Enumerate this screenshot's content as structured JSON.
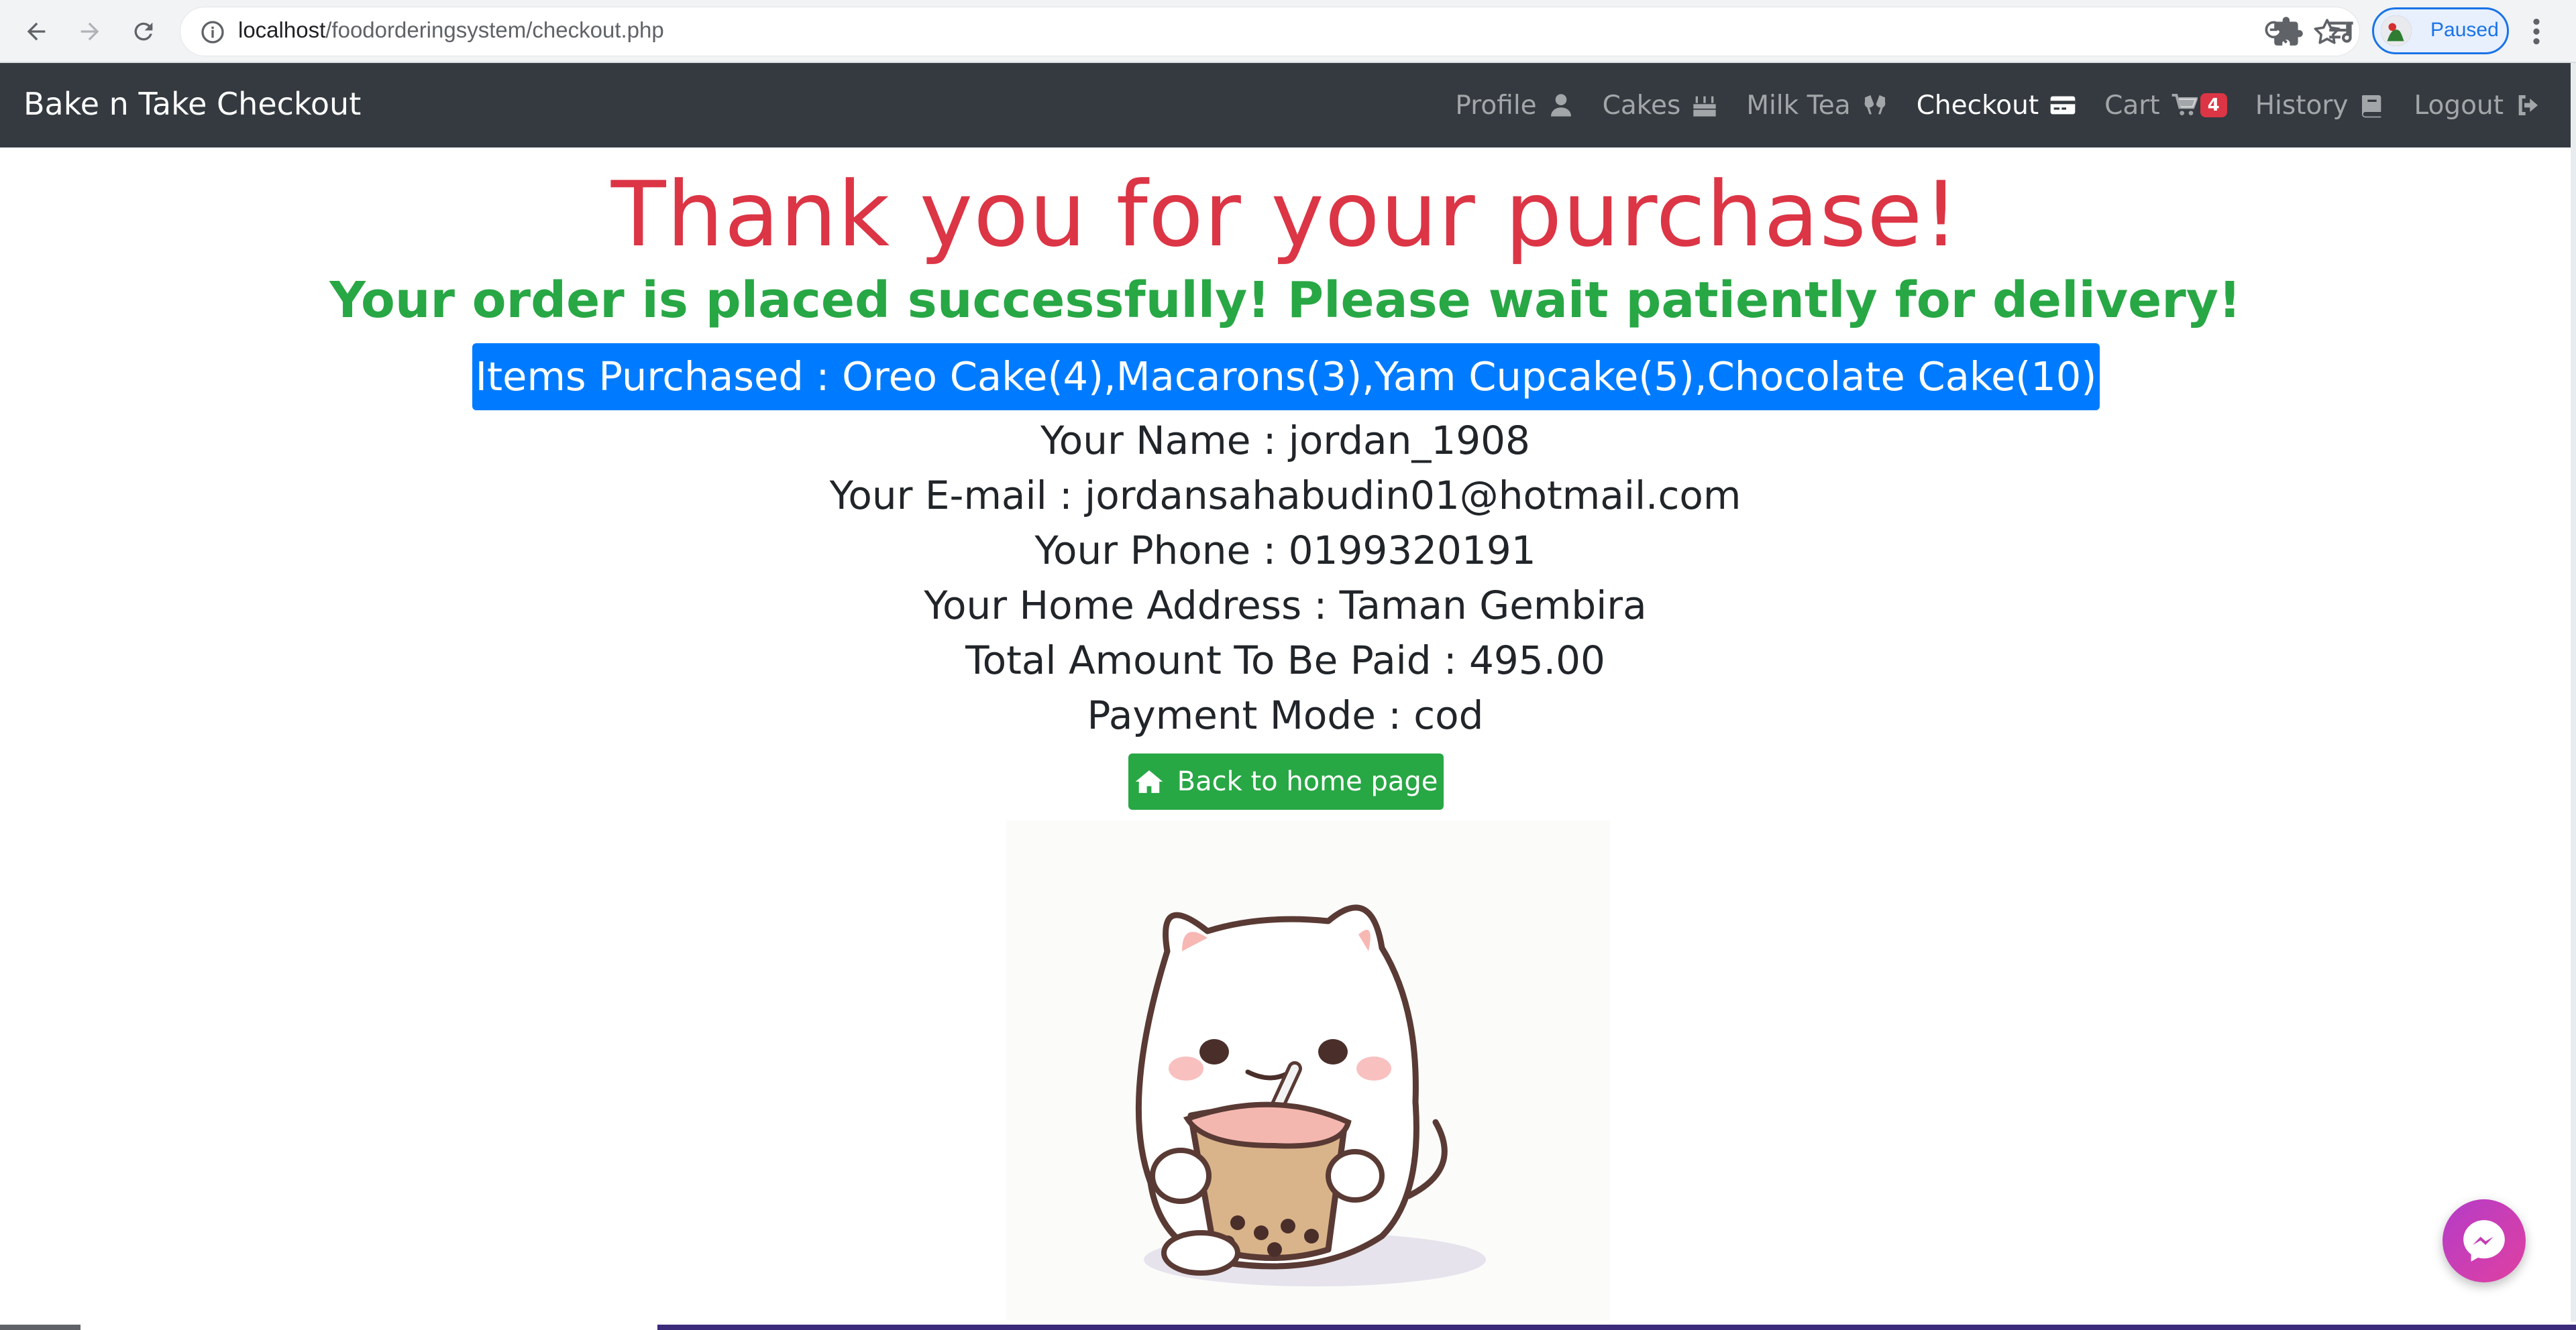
{
  "browser": {
    "url_host": "localhost",
    "url_path": "/foodorderingsystem/checkout.php",
    "profile_status": "Paused"
  },
  "navbar": {
    "brand": "Bake n Take Checkout",
    "items": [
      {
        "label": "Profile",
        "icon": "user-icon",
        "active": false
      },
      {
        "label": "Cakes",
        "icon": "birthday-cake-icon",
        "active": false
      },
      {
        "label": "Milk Tea",
        "icon": "glass-cheers-icon",
        "active": false
      },
      {
        "label": "Checkout",
        "icon": "credit-card-icon",
        "active": true
      },
      {
        "label": "Cart",
        "icon": "shopping-cart-icon",
        "active": false,
        "badge": "4"
      },
      {
        "label": "History",
        "icon": "book-icon",
        "active": false
      },
      {
        "label": "Logout",
        "icon": "sign-out-icon",
        "active": false
      }
    ]
  },
  "page": {
    "heading": "Thank you for your purchase!",
    "success_message": "Your order is placed successfully! Please wait patiently for delivery!",
    "items_purchased": "Items Purchased : Oreo Cake(4),Macarons(3),Yam Cupcake(5),Chocolate Cake(10)",
    "details": {
      "name": "Your Name : jordan_1908",
      "email": "Your E-mail : jordansahabudin01@hotmail.com",
      "phone": "Your Phone : 0199320191",
      "address": "Your Home Address : Taman Gembira",
      "total": "Total Amount To Be Paid : 495.00",
      "payment": "Payment Mode : cod"
    },
    "home_button": "Back to home page",
    "home_icon": "home-icon",
    "image": "cat-drinking-bubble-tea-illustration"
  },
  "colors": {
    "navbar_bg": "#343a40",
    "heading": "#dc3545",
    "success": "#28a745",
    "info_bar": "#007bff",
    "badge": "#dc3545"
  }
}
